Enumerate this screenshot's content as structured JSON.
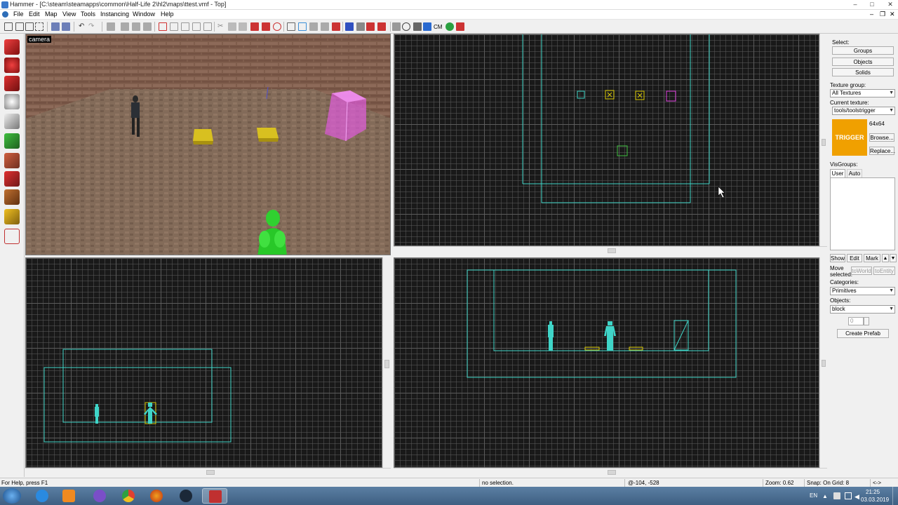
{
  "window": {
    "title": "Hammer - [C:\\steam\\steamapps\\common\\Half-Life 2\\hl2\\maps\\ttest.vmf - Top]",
    "min_icon": "–",
    "max_icon": "□",
    "close_icon": "✕"
  },
  "menubar": {
    "items": [
      "File",
      "Edit",
      "Map",
      "View",
      "Tools",
      "Instancing",
      "Window",
      "Help"
    ],
    "doc_min": "–",
    "doc_restore": "❐",
    "doc_close": "✕"
  },
  "toolbar": {
    "cm_label": "CM"
  },
  "viewports": {
    "camera_label": "camera"
  },
  "panel": {
    "select_label": "Select:",
    "groups": "Groups",
    "objects": "Objects",
    "solids": "Solids",
    "texture_group_label": "Texture group:",
    "texture_group_value": "All Textures",
    "current_texture_label": "Current texture:",
    "current_texture_value": "tools/toolstrigger",
    "texture_preview_text": "TRIGGER",
    "texture_size": "64x64",
    "browse": "Browse...",
    "replace": "Replace...",
    "visgroups_label": "VisGroups:",
    "tab_user": "User",
    "tab_auto": "Auto",
    "show": "Show",
    "edit": "Edit",
    "mark": "Mark",
    "up": "▲",
    "down": "▼",
    "move_selected": "Move\nselected:",
    "to_world": "toWorld",
    "to_entity": "toEntity",
    "categories_label": "Categories:",
    "categories_value": "Primitives",
    "objects_label": "Objects:",
    "objects_value": "block",
    "faces_value": "0",
    "create_prefab": "Create Prefab"
  },
  "status": {
    "help": "For Help, press F1",
    "selection": "no selection.",
    "coords": "@-104, -528",
    "zoom": "Zoom: 0.62",
    "snap": "Snap: On Grid: 8",
    "arrows": "<->"
  },
  "taskbar": {
    "lang": "EN",
    "time": "21:25",
    "date": "03.03.2019"
  },
  "colors": {
    "accent_cyan": "#3fd5c8",
    "trigger_orange": "#f0a000",
    "entity_yellow": "#d8c800",
    "entity_magenta": "#e040e0",
    "entity_green": "#40c040"
  }
}
